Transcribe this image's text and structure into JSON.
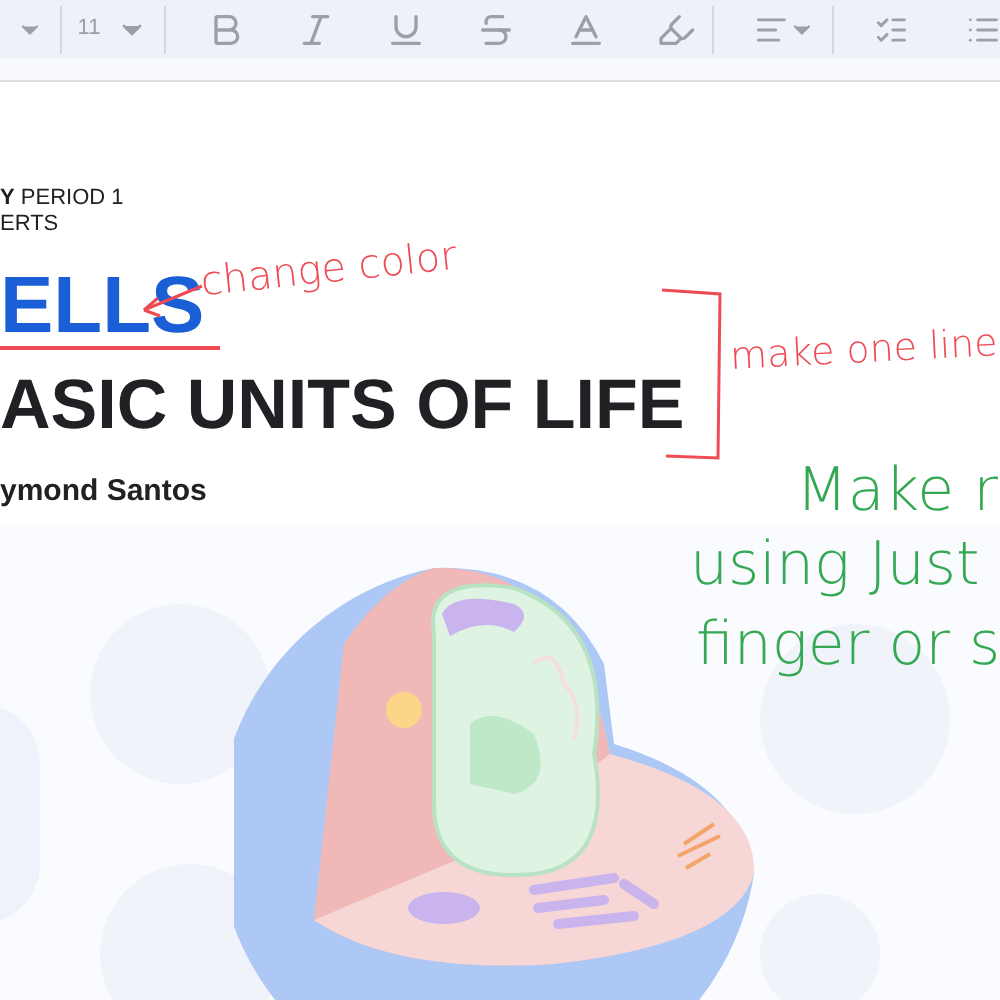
{
  "toolbar": {
    "font_size": "11"
  },
  "document": {
    "header_lines": [
      "**Y** PERIOD 1",
      "ERTS"
    ],
    "title_line_1": "ELLS",
    "title_line_2": "ASIC UNITS OF LIFE",
    "author": "ymond Santos"
  },
  "annotations": [
    {
      "text": "change color",
      "color": "#ee4b55"
    },
    {
      "text": "make one line",
      "color": "#ee4b55"
    },
    {
      "text": "Make r",
      "color": "#34a853"
    },
    {
      "text": "using Just",
      "color": "#34a853"
    },
    {
      "text": "finger or s",
      "color": "#34a853"
    }
  ]
}
